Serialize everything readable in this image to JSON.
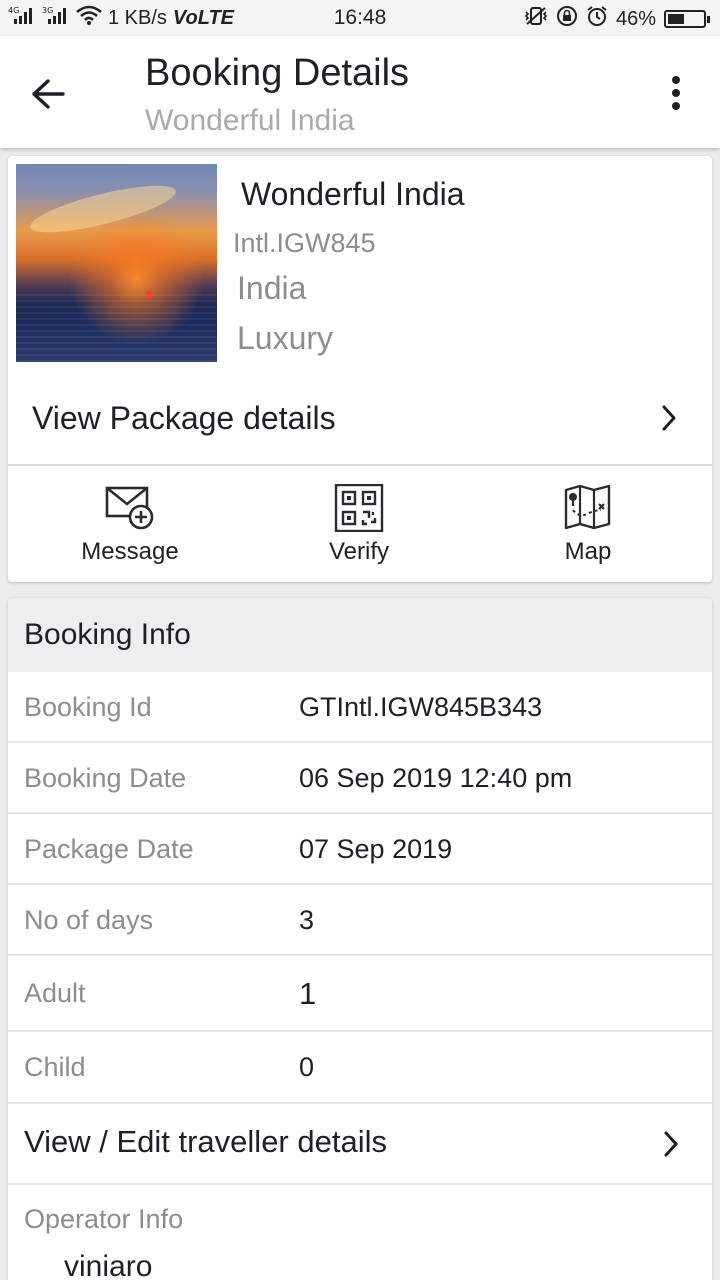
{
  "status_bar": {
    "network_1": "4G",
    "network_2": "3G",
    "speed": "1 KB/s",
    "volte": "VoLTE",
    "time": "16:48",
    "battery": "46%",
    "battery_level": 0.46
  },
  "header": {
    "title": "Booking Details",
    "subtitle": "Wonderful India",
    "back_icon": "arrow-left-icon",
    "menu_icon": "more-vertical-icon"
  },
  "package": {
    "name": "Wonderful India",
    "code": "Intl.IGW845",
    "country": "India",
    "category": "Luxury",
    "view_details_label": "View Package details",
    "actions": [
      {
        "label": "Message",
        "icon": "mail-plus-icon"
      },
      {
        "label": "Verify",
        "icon": "qr-code-icon"
      },
      {
        "label": "Map",
        "icon": "map-icon"
      }
    ]
  },
  "booking_info": {
    "title": "Booking Info",
    "rows": [
      {
        "key": "Booking Id",
        "value": "GTIntl.IGW845B343"
      },
      {
        "key": "Booking Date",
        "value": "06 Sep 2019 12:40 pm"
      },
      {
        "key": "Package Date",
        "value": "07 Sep 2019"
      },
      {
        "key": "No of days",
        "value": "3"
      },
      {
        "key": "Adult",
        "value": "1"
      },
      {
        "key": "Child",
        "value": "0"
      }
    ],
    "traveller_label": "View / Edit traveller details",
    "operator_label": "Operator Info",
    "operator_name": "viniaro"
  },
  "colors": {
    "text_primary": "#1f1f29",
    "text_secondary": "#8c8c92",
    "background": "#ececee",
    "card": "#ffffff"
  }
}
